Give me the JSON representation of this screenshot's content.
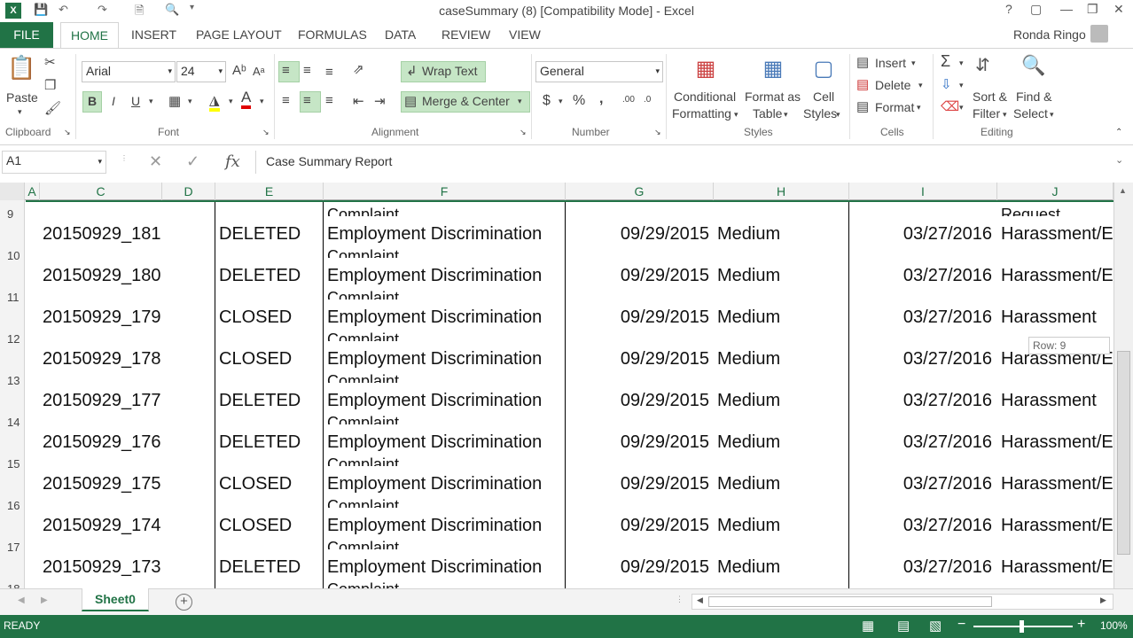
{
  "window": {
    "title": "caseSummary (8)  [Compatibility Mode] - Excel",
    "help": "?",
    "user": "Ronda Ringo"
  },
  "tabs": [
    "FILE",
    "HOME",
    "INSERT",
    "PAGE LAYOUT",
    "FORMULAS",
    "DATA",
    "REVIEW",
    "VIEW"
  ],
  "ribbon": {
    "clipboard": {
      "paste": "Paste",
      "label": "Clipboard"
    },
    "font": {
      "name": "Arial",
      "size": "24",
      "bold": "B",
      "italic": "I",
      "underline": "U",
      "label": "Font"
    },
    "alignment": {
      "wrap": "Wrap Text",
      "merge": "Merge & Center",
      "label": "Alignment"
    },
    "number": {
      "format": "General",
      "currency": "$",
      "percent": "%",
      "comma": ",",
      "label": "Number"
    },
    "styles": {
      "cond1": "Conditional",
      "cond2": "Formatting",
      "fmt1": "Format as",
      "fmt2": "Table",
      "cell1": "Cell",
      "cell2": "Styles",
      "label": "Styles"
    },
    "cells": {
      "insert": "Insert",
      "delete": "Delete",
      "format": "Format",
      "label": "Cells"
    },
    "editing": {
      "sort1": "Sort &",
      "sort2": "Filter",
      "find1": "Find &",
      "find2": "Select",
      "label": "Editing"
    }
  },
  "formula_bar": {
    "name_box": "A1",
    "content": "Case Summary Report",
    "fx": "fx"
  },
  "columns": [
    "A",
    "C",
    "D",
    "E",
    "F",
    "G",
    "H",
    "I",
    "J"
  ],
  "rows": [
    {
      "num": "9",
      "id": "",
      "status": "",
      "type": "",
      "date": "",
      "priority": "",
      "due": "",
      "cat": ""
    },
    {
      "num": "10",
      "id": "20150929_181",
      "status": "DELETED",
      "type": "Employment Discrimination",
      "date": "09/29/2015",
      "priority": "Medium",
      "due": "03/27/2016",
      "cat": "Harassment/E"
    },
    {
      "num": "11",
      "id": "20150929_180",
      "status": "DELETED",
      "type": "Employment Discrimination",
      "date": "09/29/2015",
      "priority": "Medium",
      "due": "03/27/2016",
      "cat": "Harassment/E"
    },
    {
      "num": "12",
      "id": "20150929_179",
      "status": "CLOSED",
      "type": "Employment Discrimination",
      "date": "09/29/2015",
      "priority": "Medium",
      "due": "03/27/2016",
      "cat": "Harassment"
    },
    {
      "num": "13",
      "id": "20150929_178",
      "status": "CLOSED",
      "type": "Employment Discrimination",
      "date": "09/29/2015",
      "priority": "Medium",
      "due": "03/27/2016",
      "cat": "Harassment/E"
    },
    {
      "num": "14",
      "id": "20150929_177",
      "status": "DELETED",
      "type": "Employment Discrimination",
      "date": "09/29/2015",
      "priority": "Medium",
      "due": "03/27/2016",
      "cat": "Harassment"
    },
    {
      "num": "15",
      "id": "20150929_176",
      "status": "DELETED",
      "type": "Employment Discrimination",
      "date": "09/29/2015",
      "priority": "Medium",
      "due": "03/27/2016",
      "cat": "Harassment/E"
    },
    {
      "num": "16",
      "id": "20150929_175",
      "status": "CLOSED",
      "type": "Employment Discrimination",
      "date": "09/29/2015",
      "priority": "Medium",
      "due": "03/27/2016",
      "cat": "Harassment/E"
    },
    {
      "num": "17",
      "id": "20150929_174",
      "status": "CLOSED",
      "type": "Employment Discrimination",
      "date": "09/29/2015",
      "priority": "Medium",
      "due": "03/27/2016",
      "cat": "Harassment/E"
    },
    {
      "num": "18",
      "id": "20150929_173",
      "status": "DELETED",
      "type": "Employment Discrimination",
      "date": "09/29/2015",
      "priority": "Medium",
      "due": "03/27/2016",
      "cat": "Harassment/E"
    }
  ],
  "overflow_text": {
    "complaint": "Complaint",
    "request": "Request"
  },
  "tooltip": "Row: 9",
  "sheet": {
    "name": "Sheet0",
    "add": "+"
  },
  "status": {
    "ready": "READY",
    "zoom": "100%"
  }
}
